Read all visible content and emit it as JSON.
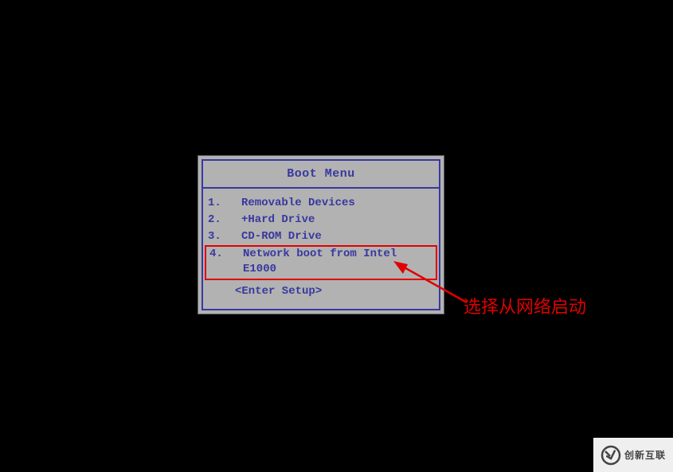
{
  "boot_menu": {
    "title": "Boot Menu",
    "items": [
      {
        "num": "1.",
        "label": " Removable Devices"
      },
      {
        "num": "2.",
        "label": "+Hard Drive"
      },
      {
        "num": "3.",
        "label": " CD-ROM Drive"
      },
      {
        "num": "4.",
        "label": " Network boot from Intel E1000"
      }
    ],
    "enter_setup": "<Enter Setup>"
  },
  "annotation": {
    "text": "选择从网络启动"
  },
  "watermark": {
    "brand": "创新互联"
  }
}
